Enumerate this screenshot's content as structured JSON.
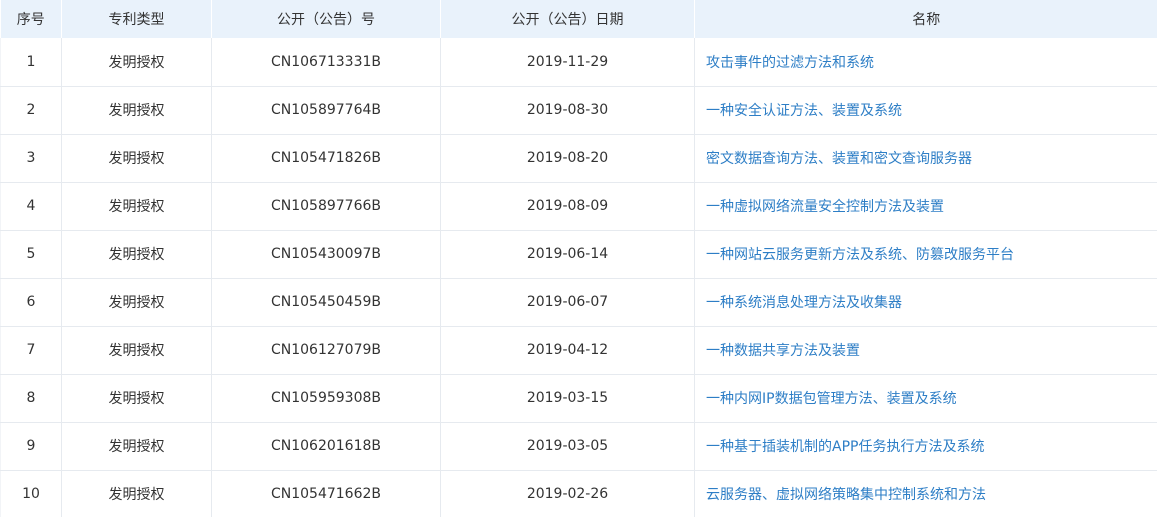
{
  "table": {
    "headers": [
      "序号",
      "专利类型",
      "公开（公告）号",
      "公开（公告）日期",
      "名称"
    ],
    "rows": [
      {
        "no": "1",
        "type": "发明授权",
        "pub_no": "CN106713331B",
        "date": "2019-11-29",
        "name": "攻击事件的过滤方法和系统"
      },
      {
        "no": "2",
        "type": "发明授权",
        "pub_no": "CN105897764B",
        "date": "2019-08-30",
        "name": "一种安全认证方法、装置及系统"
      },
      {
        "no": "3",
        "type": "发明授权",
        "pub_no": "CN105471826B",
        "date": "2019-08-20",
        "name": "密文数据查询方法、装置和密文查询服务器"
      },
      {
        "no": "4",
        "type": "发明授权",
        "pub_no": "CN105897766B",
        "date": "2019-08-09",
        "name": "一种虚拟网络流量安全控制方法及装置"
      },
      {
        "no": "5",
        "type": "发明授权",
        "pub_no": "CN105430097B",
        "date": "2019-06-14",
        "name": "一种网站云服务更新方法及系统、防篡改服务平台"
      },
      {
        "no": "6",
        "type": "发明授权",
        "pub_no": "CN105450459B",
        "date": "2019-06-07",
        "name": "一种系统消息处理方法及收集器"
      },
      {
        "no": "7",
        "type": "发明授权",
        "pub_no": "CN106127079B",
        "date": "2019-04-12",
        "name": "一种数据共享方法及装置"
      },
      {
        "no": "8",
        "type": "发明授权",
        "pub_no": "CN105959308B",
        "date": "2019-03-15",
        "name": "一种内网IP数据包管理方法、装置及系统"
      },
      {
        "no": "9",
        "type": "发明授权",
        "pub_no": "CN106201618B",
        "date": "2019-03-05",
        "name": "一种基于插装机制的APP任务执行方法及系统"
      },
      {
        "no": "10",
        "type": "发明授权",
        "pub_no": "CN105471662B",
        "date": "2019-02-26",
        "name": "云服务器、虚拟网络策略集中控制系统和方法"
      }
    ]
  },
  "colors": {
    "header_bg": "#e9f2fb",
    "link": "#2d7ec6",
    "text": "#333333",
    "border": "#e6eaef"
  }
}
